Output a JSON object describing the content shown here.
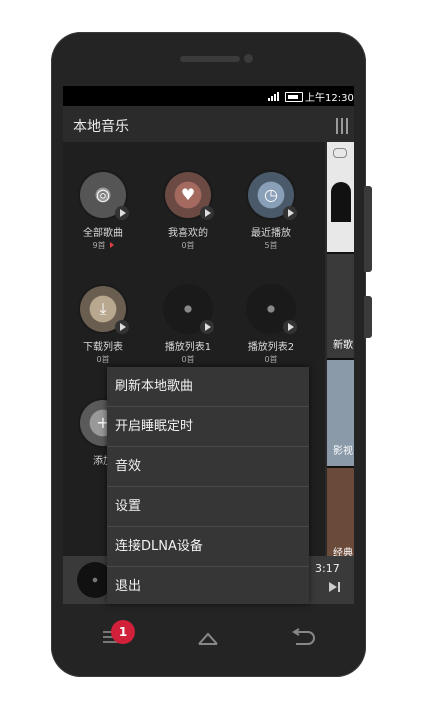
{
  "status": {
    "time": "上午12:30"
  },
  "header": {
    "title": "本地音乐"
  },
  "grid": [
    {
      "label": "全部歌曲",
      "count": "9首",
      "icon": "target-icon"
    },
    {
      "label": "我喜欢的",
      "count": "0首",
      "icon": "heart-icon"
    },
    {
      "label": "最近播放",
      "count": "5首",
      "icon": "clock-icon"
    },
    {
      "label": "下载列表",
      "count": "0首",
      "icon": "download-icon"
    },
    {
      "label": "播放列表1",
      "count": "0首",
      "icon": "disc-icon"
    },
    {
      "label": "播放列表2",
      "count": "0首",
      "icon": "disc-icon"
    },
    {
      "label": "添加",
      "count": "",
      "icon": "plus-icon"
    }
  ],
  "right_panel": {
    "label1": "新歌",
    "label2": "影视",
    "label3": "经典"
  },
  "player": {
    "time": "3:17"
  },
  "menu": {
    "items": [
      "刷新本地歌曲",
      "开启睡眠定时",
      "音效",
      "设置",
      "连接DLNA设备",
      "退出"
    ]
  },
  "nav": {
    "badge": "1"
  }
}
